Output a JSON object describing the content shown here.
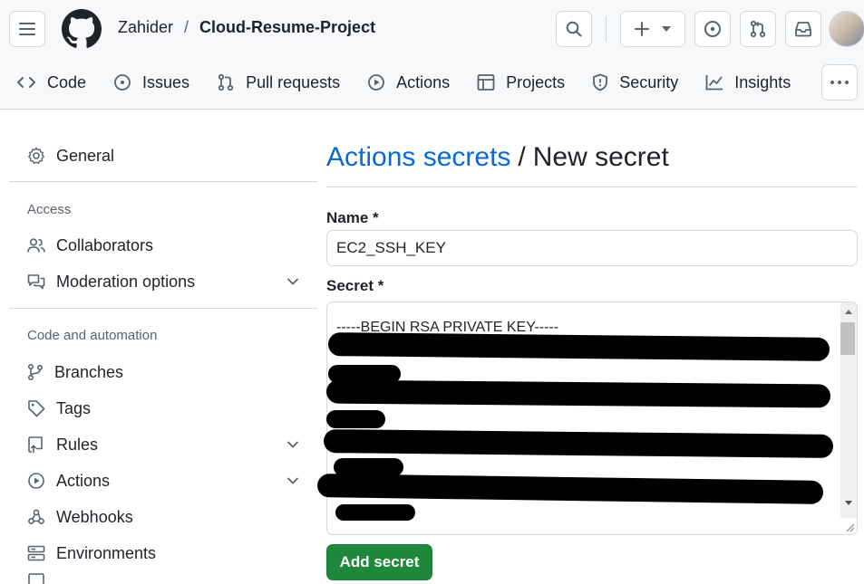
{
  "header": {
    "owner": "Zahider",
    "separator": "/",
    "repo": "Cloud-Resume-Project"
  },
  "tabs": [
    {
      "label": "Code",
      "icon": "code-icon"
    },
    {
      "label": "Issues",
      "icon": "issue-opened-icon"
    },
    {
      "label": "Pull requests",
      "icon": "git-pull-request-icon"
    },
    {
      "label": "Actions",
      "icon": "play-icon"
    },
    {
      "label": "Projects",
      "icon": "table-icon"
    },
    {
      "label": "Security",
      "icon": "shield-icon"
    },
    {
      "label": "Insights",
      "icon": "graph-icon"
    }
  ],
  "sidebar": {
    "general": "General",
    "access_heading": "Access",
    "collaborators": "Collaborators",
    "moderation": "Moderation options",
    "automation_heading": "Code and automation",
    "branches": "Branches",
    "tags": "Tags",
    "rules": "Rules",
    "actions": "Actions",
    "webhooks": "Webhooks",
    "environments": "Environments"
  },
  "main": {
    "title_link": "Actions secrets",
    "title_sep": "/",
    "title_current": "New secret",
    "name_label": "Name *",
    "name_value": "EC2_SSH_KEY",
    "secret_label": "Secret *",
    "secret_first_line": "-----BEGIN RSA PRIVATE KEY-----",
    "add_button": "Add secret"
  },
  "colors": {
    "accent_link": "#0969da",
    "primary_button": "#1f883d",
    "border": "#d1d9e0",
    "header_bg": "#f6f8fa"
  }
}
